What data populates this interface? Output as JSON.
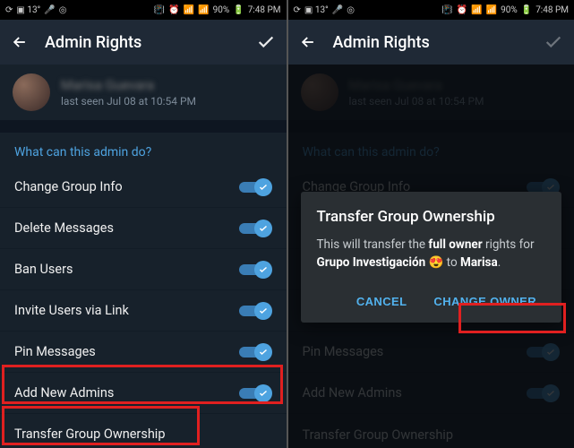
{
  "status": {
    "left_icons": [
      "steam",
      "square-13",
      "mic",
      "target"
    ],
    "right_icons": [
      "vibrate",
      "alarm",
      "wifi",
      "signal",
      "signal"
    ],
    "battery": "90%",
    "time": "7:48 PM"
  },
  "header": {
    "title": "Admin Rights"
  },
  "user": {
    "name": "Marisa Guevara",
    "status": "last seen Jul 08 at 10:54 PM"
  },
  "section": {
    "header": "What can this admin do?"
  },
  "perms": [
    {
      "label": "Change Group Info",
      "on": true
    },
    {
      "label": "Delete Messages",
      "on": true
    },
    {
      "label": "Ban Users",
      "on": true
    },
    {
      "label": "Invite Users via Link",
      "on": true
    },
    {
      "label": "Pin Messages",
      "on": true
    },
    {
      "label": "Add New Admins",
      "on": true
    }
  ],
  "transfer": {
    "label": "Transfer Group Ownership"
  },
  "dialog": {
    "title": "Transfer Group Ownership",
    "body_pre": "This will transfer the ",
    "body_bold1": "full owner",
    "body_mid": " rights for ",
    "body_bold2": "Grupo Investigación",
    "emoji": "😍",
    "body_mid2": " to ",
    "body_bold3": "Marisa",
    "body_post": ".",
    "cancel": "CANCEL",
    "confirm": "CHANGE OWNER"
  }
}
